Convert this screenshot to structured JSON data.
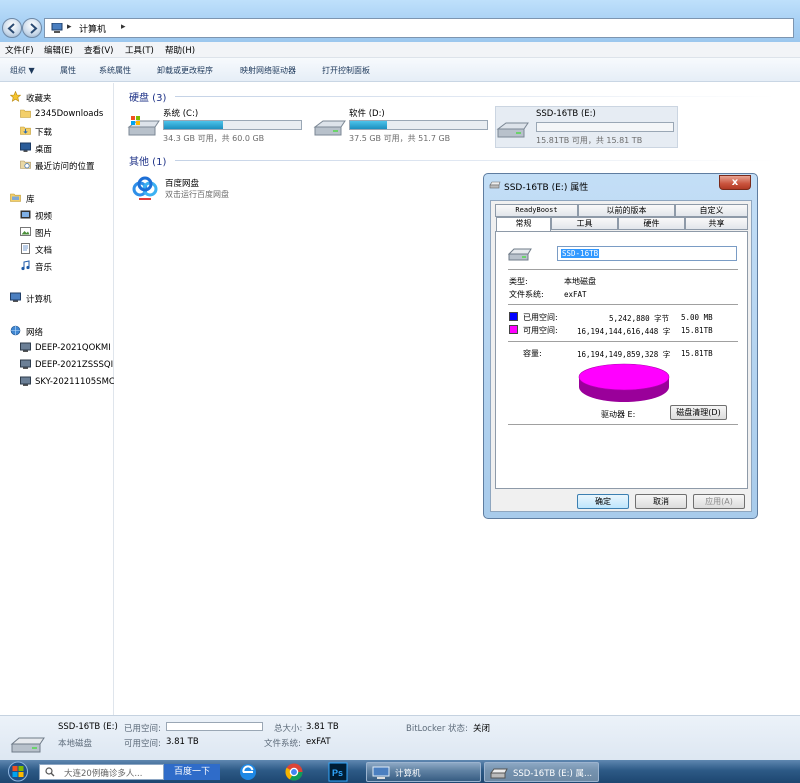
{
  "address": {
    "path_item": "计算机"
  },
  "menu": [
    "文件(F)",
    "编辑(E)",
    "查看(V)",
    "工具(T)",
    "帮助(H)"
  ],
  "toolbar": [
    "组织 ▼",
    "属性",
    "系统属性",
    "卸载或更改程序",
    "映射网络驱动器",
    "打开控制面板"
  ],
  "sidebar": {
    "favorites": {
      "label": "收藏夹",
      "items": [
        "2345Downloads",
        "下载",
        "桌面",
        "最近访问的位置"
      ]
    },
    "libraries": {
      "label": "库",
      "items": [
        "视频",
        "图片",
        "文档",
        "音乐"
      ]
    },
    "computer": "计算机",
    "network": {
      "label": "网络",
      "items": [
        "DEEP-2021QOKMI",
        "DEEP-2021ZSSSQI",
        "SKY-20211105SMC"
      ]
    }
  },
  "groups": {
    "drives": "硬盘 (3)",
    "other": "其他 (1)"
  },
  "drives": [
    {
      "name": "系统 (C:)",
      "size": "34.3 GB 可用，共 60.0 GB",
      "used_fraction": 0.43
    },
    {
      "name": "软件 (D:)",
      "size": "37.5 GB 可用，共 51.7 GB",
      "used_fraction": 0.27
    },
    {
      "name": "SSD-16TB (E:)",
      "size": "15.81TB 可用，共 15.81 TB",
      "used_fraction": 0.0
    }
  ],
  "other_items": [
    {
      "name": "百度网盘",
      "desc": "双击运行百度网盘"
    }
  ],
  "dialog": {
    "title": "SSD-16TB (E:) 属性",
    "close": "x",
    "tabs_top": [
      "ReadyBoost",
      "以前的版本",
      "自定义"
    ],
    "tabs_bottom": [
      "常规",
      "工具",
      "硬件",
      "共享"
    ],
    "name": "SSD-16TB",
    "type_label": "类型:",
    "type_value": "本地磁盘",
    "fs_label": "文件系统:",
    "fs_value": "exFAT",
    "used_label": "已用空间:",
    "used_bytes": "5,242,880 字节",
    "used_size": "5.00 MB",
    "free_label": "可用空间:",
    "free_bytes": "16,194,144,616,448 字",
    "free_size": "15.81TB",
    "cap_label": "容量:",
    "cap_bytes": "16,194,149,859,328 字",
    "cap_size": "15.81TB",
    "drive_label": "驱动器 E:",
    "cleanup": "磁盘清理(D)",
    "ok": "确定",
    "cancel": "取消",
    "apply": "应用(A)",
    "colors": {
      "used": "#0000ff",
      "free": "#ff00ff"
    }
  },
  "details": {
    "name": "SSD-16TB (E:)",
    "type": "本地磁盘",
    "used_k": "已用空间:",
    "free_k": "可用空间:",
    "free_v": "3.81 TB",
    "total_k": "总大小:",
    "total_v": "3.81 TB",
    "fs_k": "文件系统:",
    "fs_v": "exFAT",
    "bitlocker_k": "BitLocker 状态:",
    "bitlocker_v": "关闭"
  },
  "taskbar": {
    "search_placeholder": "大连20例确诊多人...",
    "search_button": "百度一下",
    "windows": [
      "计算机",
      "SSD-16TB (E:) 属..."
    ]
  }
}
